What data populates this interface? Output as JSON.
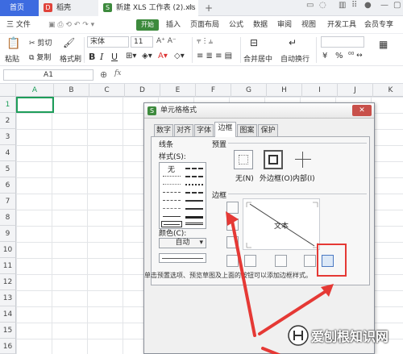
{
  "tabs": {
    "home": "首页",
    "shell": "稻壳",
    "doc": "新建 XLS 工作表 (2).xls"
  },
  "menu": {
    "file": "三 文件",
    "start": "开始",
    "items": [
      "插入",
      "页面布局",
      "公式",
      "数据",
      "审阅",
      "视图",
      "开发工具",
      "会员专享"
    ]
  },
  "toolbar": {
    "paste": "粘贴",
    "cut": "剪切",
    "copy": "复制",
    "format_painter": "格式刷",
    "font_name": "宋体",
    "font_size": "11",
    "merge_center": "合并居中",
    "wrap_text": "自动换行",
    "currency": "¥",
    "percent": "%"
  },
  "formula_bar": {
    "cell_ref": "A1",
    "fx": "fx"
  },
  "grid": {
    "columns": [
      "A",
      "B",
      "C",
      "D",
      "E",
      "F",
      "G",
      "H",
      "I",
      "J",
      "K"
    ],
    "rows": [
      "1",
      "2",
      "3",
      "4",
      "5",
      "6",
      "7",
      "8",
      "9",
      "10",
      "11",
      "12",
      "13",
      "14",
      "15",
      "16"
    ]
  },
  "dialog": {
    "title": "单元格格式",
    "close": "✕",
    "tabs": [
      "数字",
      "对齐",
      "字体",
      "边框",
      "图案",
      "保护"
    ],
    "active_tab": "边框",
    "line_group": "线条",
    "style_label": "样式(S):",
    "none_label": "无",
    "color_label": "颜色(C):",
    "color_value": "自动",
    "preset_group": "预置",
    "presets": [
      "无(N)",
      "外边框(O)",
      "内部(I)"
    ],
    "border_group": "边框",
    "preview_text": "文本",
    "hint": "单击预置选项、预览草图及上面的按钮可以添加边框样式。"
  },
  "watermark": {
    "text": "爱刨根知识网"
  },
  "colors": {
    "home_tab": "#3d6be0",
    "start_button": "#3d8a3d",
    "highlight": "#e53935",
    "active_cell": "#1e9e5a"
  }
}
